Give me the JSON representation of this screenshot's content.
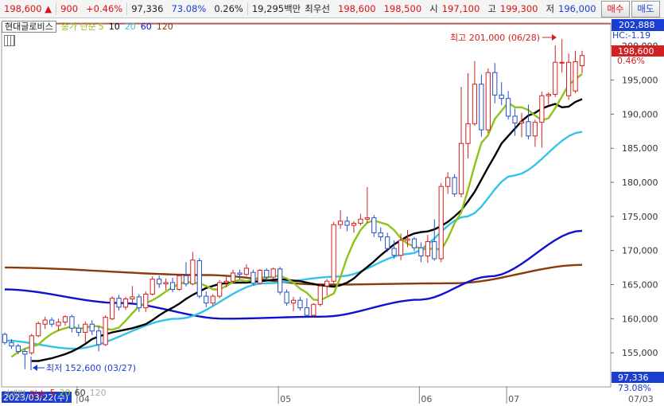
{
  "quote": {
    "price": "198,600",
    "arrow": "▲",
    "change": "900",
    "change_pct": "+0.46%",
    "volume": "97,336",
    "vol_ratio": "73.08%",
    "turnover": "0.26%",
    "amount": "19,295백만",
    "best_label": "최우선",
    "best_ask": "198,600",
    "best_bid": "198,500",
    "open_label": "시",
    "open": "197,100",
    "high_label": "고",
    "high": "199,300",
    "low_label": "저",
    "low": "196,000",
    "buy_label": "매수",
    "sell_label": "매도"
  },
  "legend": {
    "stock_name": "현대글로비스",
    "ma_label": "종가 단순",
    "ma5": "5",
    "ma10": "10",
    "ma20": "20",
    "ma60": "60",
    "ma120": "120"
  },
  "volume_legend": {
    "label": "거래량",
    "type": "단순",
    "p5": "5",
    "p20": "20",
    "p60": "60",
    "p120": "120"
  },
  "annotations": {
    "high": "최고 201,000 (06/28)",
    "low": "최저 152,600 (03/27)",
    "hc": "HC:-1.19",
    "max_axis": "202,888",
    "current_price": "198,600",
    "current_pct": "0.46%",
    "volume_value": "97,336",
    "volume_pct": "73.08%",
    "start_date": "2023/03/22(수)"
  },
  "colors": {
    "up": "#d42020",
    "down": "#2450c8",
    "ma5": "#8fc21b",
    "ma10": "#000000",
    "ma20": "#33c3ea",
    "ma60": "#1010d0",
    "ma120": "#8b3a0a"
  },
  "chart_data": {
    "type": "candlestick",
    "ylim": [
      150000,
      202888
    ],
    "y_ticks": [
      155000,
      160000,
      165000,
      170000,
      175000,
      180000,
      185000,
      190000,
      195000,
      200000
    ],
    "y_tick_labels": [
      "155,000",
      "160,000",
      "165,000",
      "170,000",
      "175,000",
      "180,000",
      "185,000",
      "190,000",
      "195,000",
      "200,000"
    ],
    "x_labels": [
      "04",
      "05",
      "06",
      "07",
      "07/03"
    ],
    "x_label_index": [
      11,
      41,
      62,
      75,
      79
    ],
    "candles": [
      [
        157700,
        158000,
        156200,
        156500
      ],
      [
        156500,
        157000,
        155600,
        156000
      ],
      [
        156000,
        156300,
        154800,
        155200
      ],
      [
        155200,
        155600,
        152600,
        154800
      ],
      [
        155000,
        157800,
        154700,
        157500
      ],
      [
        157500,
        159600,
        157300,
        159300
      ],
      [
        159200,
        160300,
        158500,
        159800
      ],
      [
        159800,
        160200,
        158800,
        159200
      ],
      [
        159000,
        160000,
        158200,
        159500
      ],
      [
        159500,
        160500,
        159000,
        160300
      ],
      [
        160300,
        160600,
        158000,
        158600
      ],
      [
        158600,
        159200,
        157400,
        158000
      ],
      [
        158000,
        159600,
        156500,
        159200
      ],
      [
        159200,
        159800,
        157600,
        158200
      ],
      [
        158200,
        158900,
        155200,
        156200
      ],
      [
        156200,
        160500,
        156000,
        160200
      ],
      [
        160000,
        163300,
        159800,
        163000
      ],
      [
        163000,
        163500,
        161200,
        161700
      ],
      [
        161700,
        163200,
        161300,
        162900
      ],
      [
        162900,
        164800,
        162300,
        163200
      ],
      [
        163200,
        163600,
        161000,
        161600
      ],
      [
        161600,
        164000,
        161000,
        163600
      ],
      [
        163600,
        166200,
        163400,
        165800
      ],
      [
        165800,
        166300,
        164500,
        165100
      ],
      [
        165100,
        165900,
        164200,
        165300
      ],
      [
        165300,
        166000,
        163900,
        164300
      ],
      [
        164300,
        166500,
        164100,
        166300
      ],
      [
        166300,
        168300,
        164700,
        165100
      ],
      [
        165100,
        169800,
        164900,
        168600
      ],
      [
        168500,
        168900,
        163000,
        163300
      ],
      [
        163300,
        164000,
        161700,
        162300
      ],
      [
        162300,
        163600,
        161900,
        163300
      ],
      [
        163300,
        165700,
        163000,
        165300
      ],
      [
        165300,
        166300,
        164600,
        165500
      ],
      [
        165500,
        167200,
        165300,
        166700
      ],
      [
        166700,
        167200,
        165800,
        166500
      ],
      [
        166500,
        168000,
        166300,
        167400
      ],
      [
        166800,
        167200,
        164900,
        165200
      ],
      [
        165200,
        167300,
        165000,
        167100
      ],
      [
        167100,
        167400,
        165600,
        166100
      ],
      [
        166100,
        167500,
        165800,
        167300
      ],
      [
        167300,
        167600,
        163500,
        163900
      ],
      [
        163900,
        164300,
        161900,
        162300
      ],
      [
        162300,
        163200,
        161100,
        162700
      ],
      [
        162700,
        163200,
        161200,
        161600
      ],
      [
        161600,
        163000,
        160300,
        160500
      ],
      [
        160500,
        162300,
        160200,
        162100
      ],
      [
        162100,
        165200,
        161800,
        164800
      ],
      [
        164800,
        165800,
        163400,
        165500
      ],
      [
        165500,
        174200,
        165200,
        173800
      ],
      [
        173800,
        175900,
        173200,
        174300
      ],
      [
        174300,
        175000,
        172800,
        173700
      ],
      [
        173700,
        174300,
        172600,
        174000
      ],
      [
        174000,
        175400,
        173700,
        174600
      ],
      [
        174600,
        179300,
        174000,
        174800
      ],
      [
        174800,
        175200,
        172000,
        172600
      ],
      [
        172600,
        173400,
        171400,
        172000
      ],
      [
        172000,
        172600,
        169800,
        170300
      ],
      [
        170300,
        171500,
        168800,
        169300
      ],
      [
        169300,
        172500,
        168600,
        171500
      ],
      [
        171500,
        173000,
        170500,
        171700
      ],
      [
        171700,
        172000,
        169900,
        170400
      ],
      [
        170400,
        171200,
        168300,
        169200
      ],
      [
        169200,
        172300,
        168200,
        171300
      ],
      [
        171300,
        174600,
        168500,
        168800
      ],
      [
        168800,
        179900,
        168300,
        179400
      ],
      [
        179400,
        181500,
        178300,
        180700
      ],
      [
        180700,
        181200,
        177900,
        178300
      ],
      [
        178300,
        194000,
        177800,
        185700
      ],
      [
        185700,
        196000,
        183500,
        188600
      ],
      [
        188600,
        197800,
        188300,
        194400
      ],
      [
        194400,
        195800,
        186700,
        187700
      ],
      [
        187700,
        196700,
        187200,
        196100
      ],
      [
        196100,
        197500,
        191600,
        192800
      ],
      [
        192800,
        194700,
        191300,
        192300
      ],
      [
        192300,
        193400,
        189200,
        189700
      ],
      [
        189700,
        190800,
        186800,
        188700
      ],
      [
        188700,
        190200,
        186600,
        188900
      ],
      [
        188900,
        191400,
        186300,
        186800
      ],
      [
        186800,
        189200,
        185200,
        188800
      ],
      [
        188800,
        193300,
        185100,
        192700
      ],
      [
        192700,
        193200,
        191400,
        192900
      ],
      [
        192900,
        200100,
        192500,
        197600
      ],
      [
        197600,
        201000,
        196100,
        197600
      ],
      [
        192700,
        198900,
        192100,
        197600
      ],
      [
        193400,
        199300,
        193100,
        197700
      ],
      [
        197100,
        199300,
        196000,
        198600
      ]
    ],
    "ma": {
      "ma5": [
        154400,
        155100,
        155600,
        155900,
        156200,
        157100,
        157800,
        158300,
        158600,
        158900,
        158500,
        158700,
        158900,
        158900,
        158500,
        158400,
        158700,
        159700,
        160800,
        161800,
        162300,
        162700,
        163300,
        164000,
        164600,
        165100,
        165400,
        165300,
        165200,
        164800,
        164300,
        164300,
        164800,
        165400,
        165700,
        165500,
        165700,
        166100,
        166000,
        166200,
        166300,
        165900,
        165300,
        164400,
        163800,
        162800,
        162700,
        163200,
        163700,
        166100,
        169000,
        171300,
        173000,
        174100,
        174400,
        174100,
        173800,
        173000,
        171800,
        171000,
        170600,
        170300,
        170100,
        170400,
        170000,
        171800,
        174000,
        175600,
        178900,
        182500,
        185800,
        186900,
        189300,
        190500,
        191700,
        191000,
        191000,
        190600,
        189800,
        189100,
        189400,
        190900,
        192600,
        194300,
        195100,
        195900
      ],
      "ma10": [
        153800,
        153800,
        154000,
        154200,
        154500,
        154800,
        155200,
        155700,
        156300,
        157000,
        157400,
        157700,
        158000,
        158200,
        158400,
        158600,
        158900,
        159200,
        159800,
        160500,
        161100,
        161600,
        162200,
        162900,
        163500,
        164000,
        164500,
        164800,
        165100,
        165200,
        165300,
        165300,
        165300,
        165400,
        165500,
        165600,
        165700,
        165800,
        165700,
        165600,
        165500,
        165300,
        165100,
        164900,
        164800,
        164700,
        164900,
        165300,
        165900,
        166800,
        167600,
        168400,
        169300,
        170100,
        170900,
        171500,
        172100,
        172500,
        172700,
        172800,
        173100,
        173600,
        174200,
        175000,
        175900,
        177200,
        178600,
        180400,
        182200,
        183900,
        185700,
        186800,
        187900,
        189000,
        189800,
        190200,
        190800,
        191200,
        191500,
        191000,
        191100,
        191800,
        192200
      ]
    }
  }
}
